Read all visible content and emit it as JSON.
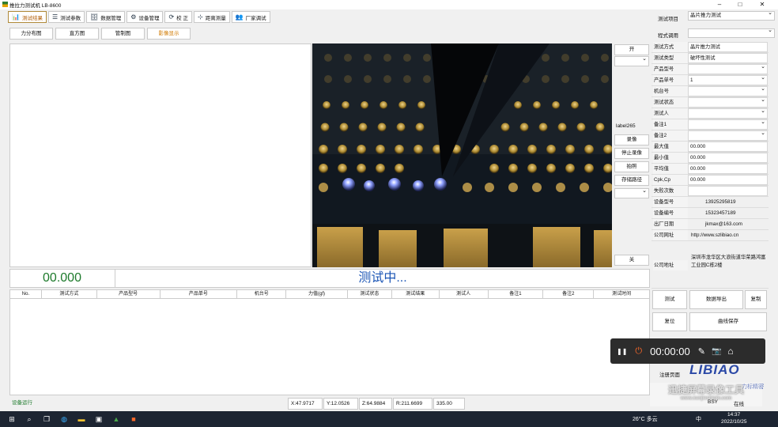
{
  "window": {
    "title": "推拉力测试机 LB-8600",
    "minimize": "–",
    "maximize": "□",
    "close": "✕"
  },
  "toolbar": [
    {
      "icon": "bar-chart-icon",
      "glyph": "📊",
      "label": "测试结果",
      "active": true
    },
    {
      "icon": "params-icon",
      "glyph": "☰",
      "label": "测试参数",
      "active": false
    },
    {
      "icon": "database-icon",
      "glyph": "🗄",
      "label": "数据管理",
      "active": false
    },
    {
      "icon": "gear-icon",
      "glyph": "⚙",
      "label": "设备管理",
      "active": false
    },
    {
      "icon": "calibrate-icon",
      "glyph": "⟳",
      "label": "校  正",
      "active": false
    },
    {
      "icon": "distance-icon",
      "glyph": "⊹",
      "label": "距离测量",
      "active": false
    },
    {
      "icon": "users-icon",
      "glyph": "👥",
      "label": "厂家调试",
      "active": false
    }
  ],
  "tabs": [
    "力分布图",
    "直方图",
    "管制图",
    "影像显示"
  ],
  "camera_controls": {
    "open": "开",
    "label": "label265",
    "record": "录像",
    "stop_record": "停止录像",
    "photo": "拍照",
    "save_path": "存储路径",
    "close": "关"
  },
  "readout": {
    "value": "00.000",
    "status": "测试中..."
  },
  "table_columns": [
    "No.",
    "测试方式",
    "产品型号",
    "产品单号",
    "机台号",
    "力值(gf)",
    "测试状态",
    "测试结果",
    "测试人",
    "备注1",
    "备注2",
    "测试时间"
  ],
  "right_top": {
    "project_label": "测试项目",
    "project_value": "晶片推力测试",
    "program_label": "程式调用",
    "program_value": ""
  },
  "properties": [
    {
      "k": "测试方式",
      "v": "晶片推力测试",
      "dd": false
    },
    {
      "k": "测试类型",
      "v": "破坏性测试",
      "dd": false
    },
    {
      "k": "产品型号",
      "v": "",
      "dd": true
    },
    {
      "k": "产品单号",
      "v": "1",
      "dd": true
    },
    {
      "k": "机台号",
      "v": "",
      "dd": true
    },
    {
      "k": "测试状态",
      "v": "",
      "dd": true
    },
    {
      "k": "测试人",
      "v": "",
      "dd": true
    },
    {
      "k": "备注1",
      "v": "",
      "dd": true
    },
    {
      "k": "备注2",
      "v": "",
      "dd": true
    },
    {
      "k": "最大值",
      "v": "00.000",
      "dd": false
    },
    {
      "k": "最小值",
      "v": "00.000",
      "dd": false
    },
    {
      "k": "平均值",
      "v": "00.000",
      "dd": false
    },
    {
      "k": "Cpk,Cp",
      "v": "00.000",
      "dd": false
    },
    {
      "k": "失败次数",
      "v": "",
      "dd": false
    }
  ],
  "info": [
    {
      "k": "设备型号",
      "v": "13925295819"
    },
    {
      "k": "设备编号",
      "v": "15323457189"
    },
    {
      "k": "出厂日期",
      "v": "jkmax@163.com"
    },
    {
      "k": "公司网址",
      "v": "http://www.szlibiao.cn"
    }
  ],
  "address": {
    "k": "公司地址",
    "v": "深圳市龙华区大浪街道华荣路鸿富工业园C栋2楼"
  },
  "buttons": {
    "test": "测试",
    "export": "数据导出",
    "reset": "复制",
    "restore": "复位",
    "curve_save": "曲线保存",
    "register": "注册页面",
    "bsy": "BSY",
    "online": "在线"
  },
  "statusbar": {
    "device": "设备运行",
    "x": "X:47.9717",
    "y": "Y:12.0526",
    "z": "Z:64.9884",
    "r": "R:211.6699",
    "v": "335.00"
  },
  "recorder": {
    "time": "00:00:00",
    "pause": "❚❚",
    "stop": "⏻",
    "pen": "✎",
    "camera": "📷",
    "home": "⌂"
  },
  "watermark": {
    "brand": "LIBIAO",
    "sub": "力标精密",
    "overlay": "迅捷屏幕录像工具",
    "url": "www.xunjieshipin.com"
  },
  "taskbar": {
    "weather": "26°C 多云",
    "time": "14:37",
    "date": "2022/10/25",
    "lang": "中"
  },
  "colors": {
    "value_green": "#1d7a2b",
    "status_blue": "#1b55b5",
    "active_tab": "#d17a00"
  }
}
